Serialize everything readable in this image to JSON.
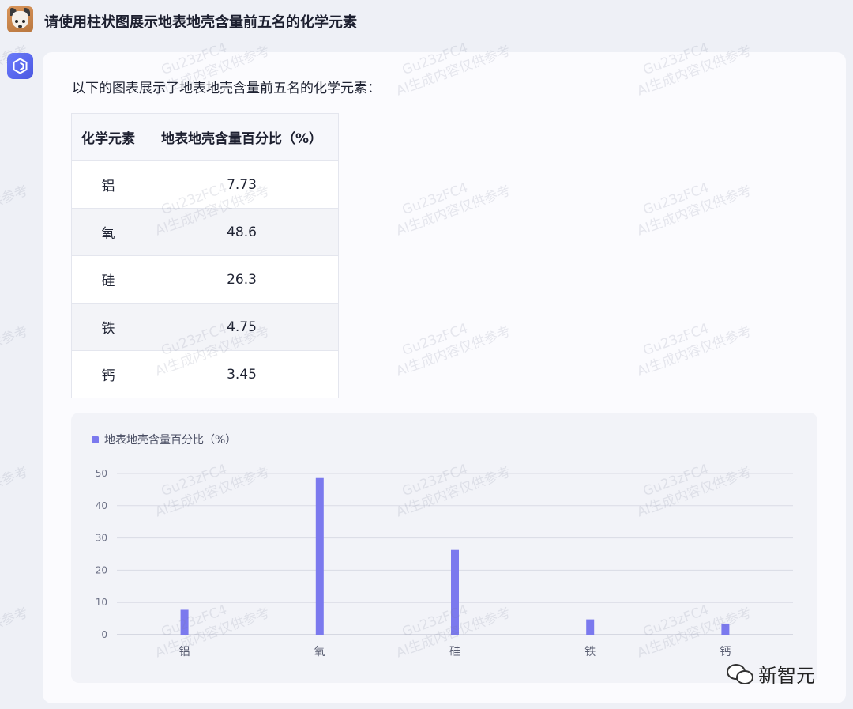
{
  "user": {
    "message": "请使用柱状图展示地表地壳含量前五名的化学元素"
  },
  "assistant": {
    "intro": "以下的图表展示了地表地壳含量前五名的化学元素：",
    "table": {
      "headers": [
        "化学元素",
        "地表地壳含量百分比（%）"
      ],
      "rows": [
        [
          "铝",
          "7.73"
        ],
        [
          "氧",
          "48.6"
        ],
        [
          "硅",
          "26.3"
        ],
        [
          "铁",
          "4.75"
        ],
        [
          "钙",
          "3.45"
        ]
      ]
    }
  },
  "watermark": {
    "line1": "Gu23zFC4",
    "line2": "AI生成内容仅供参考"
  },
  "brand": "新智元",
  "colors": {
    "bar": "#7b79ee",
    "accent": "#5b6cf5"
  },
  "chart_data": {
    "type": "bar",
    "categories": [
      "铝",
      "氧",
      "硅",
      "铁",
      "钙"
    ],
    "series": [
      {
        "name": "地表地壳含量百分比（%）",
        "values": [
          7.73,
          48.6,
          26.3,
          4.75,
          3.45
        ]
      }
    ],
    "yticks": [
      0,
      10,
      20,
      30,
      40,
      50
    ],
    "ylim": [
      0,
      50
    ],
    "grid": true,
    "legend": "top-left"
  }
}
